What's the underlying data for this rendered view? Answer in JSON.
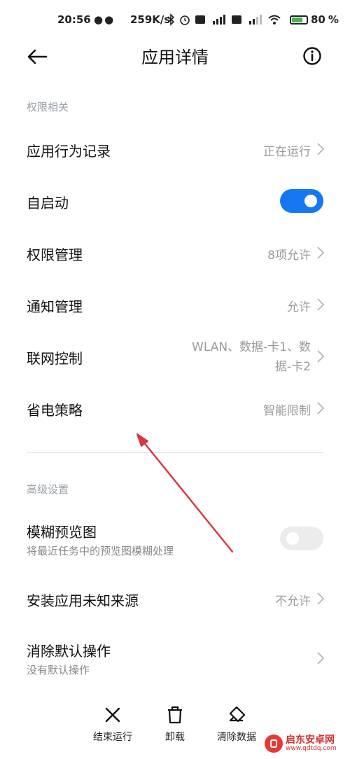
{
  "status_bar": {
    "time": "20:56",
    "indicators": "●●",
    "net_speed": "259K/s",
    "icons": [
      "wechat-icon",
      "bluetooth-icon",
      "alarm-icon",
      "hd-icon",
      "signal-5g-icon",
      "hd-icon",
      "signal-4g-icon",
      "wifi-icon"
    ],
    "battery": "80"
  },
  "header": {
    "title": "应用详情"
  },
  "sections": {
    "permissions_label": "权限相关",
    "advanced_label": "高级设置"
  },
  "rows": {
    "app_behavior": {
      "title": "应用行为记录",
      "value": "正在运行"
    },
    "autostart": {
      "title": "自启动",
      "toggle_on": true
    },
    "permission_mgmt": {
      "title": "权限管理",
      "value": "8项允许"
    },
    "notification_mgmt": {
      "title": "通知管理",
      "value": "允许"
    },
    "network_control": {
      "title": "联网控制",
      "value_line1": "WLAN、数据-卡1、数",
      "value_line2": "据-卡2"
    },
    "power_policy": {
      "title": "省电策略",
      "value": "智能限制"
    },
    "blur_preview": {
      "title": "模糊预览图",
      "subtitle": "将最近任务中的预览图模糊处理",
      "toggle_on": false
    },
    "unknown_sources": {
      "title": "安装应用未知来源",
      "value": "不允许"
    },
    "clear_defaults": {
      "title": "消除默认操作",
      "subtitle": "没有默认操作"
    }
  },
  "bottom_actions": {
    "force_stop": "结束运行",
    "uninstall": "卸载",
    "clear_data": "清除数据"
  },
  "watermark": {
    "name": "启东安卓网",
    "url": "www.qdtdq.com"
  },
  "colors": {
    "accent": "#1677f3",
    "annotation_arrow": "#d9363e",
    "secondary_text": "#9a9a9a"
  }
}
